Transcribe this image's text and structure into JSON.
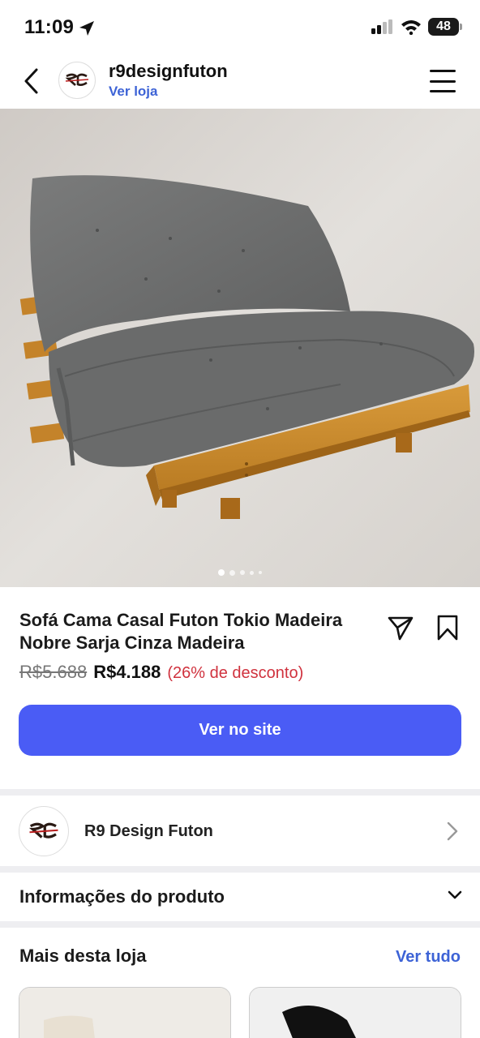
{
  "status_bar": {
    "time": "11:09",
    "battery": "48",
    "icons": [
      "location-arrow-icon",
      "signal-icon",
      "wifi-icon",
      "battery-icon"
    ]
  },
  "header": {
    "store_name": "r9designfuton",
    "store_link": "Ver loja",
    "icons": [
      "back-chevron-icon",
      "store-logo",
      "hamburger-menu-icon"
    ]
  },
  "gallery": {
    "total_images": 5,
    "current_index": 1
  },
  "product": {
    "title": "Sofá Cama Casal Futon Tokio Madeira Nobre Sarja Cinza Madeira",
    "old_price": "R$5.688",
    "price": "R$4.188",
    "discount": "(26% de desconto)",
    "cta_label": "Ver no site"
  },
  "store_row": {
    "name": "R9 Design Futon"
  },
  "product_info": {
    "label": "Informações do produto"
  },
  "more_from_store": {
    "title": "Mais desta loja",
    "see_all": "Ver tudo"
  },
  "colors": {
    "accent": "#4a5cf5",
    "link": "#3d63d6",
    "discount": "#d0323e",
    "wood": "#c98a2e",
    "cushion": "#6e6f6f"
  }
}
